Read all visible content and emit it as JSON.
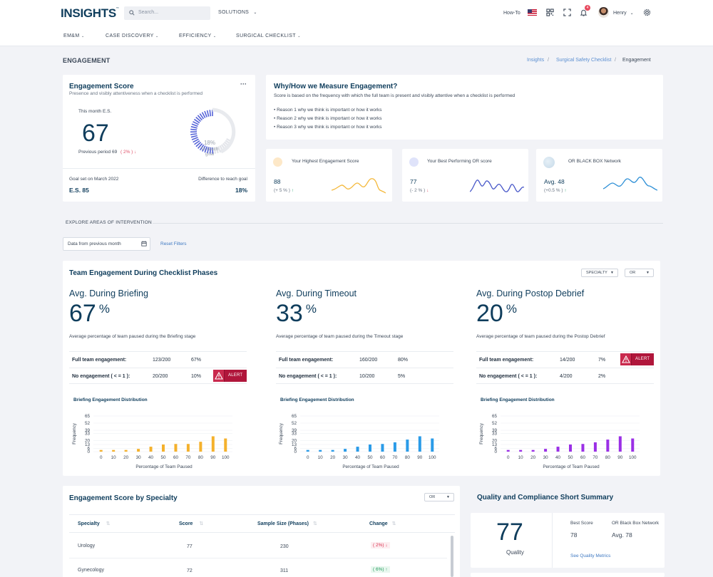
{
  "header": {
    "logo": "INSIGHTS",
    "logo_tm": "™",
    "search_placeholder": "Search...",
    "solutions": "SOLUTIONS",
    "howto": "How-To",
    "notifications_count": "4",
    "user_name": "Henry"
  },
  "nav": [
    "EM&M",
    "CASE DISCOVERY",
    "EFFICIENCY",
    "SURGICAL CHECKLIST"
  ],
  "page": {
    "title": "ENGAGEMENT",
    "breadcrumb": [
      "Insights",
      "Surgical Safety Checklist",
      "Engagement"
    ]
  },
  "es_card": {
    "title": "Engagement Score",
    "subtitle": "Presence and visibly attentiveness when a checklist is performed",
    "this_month_label": "This month E.S.",
    "value": "67",
    "previous_label": "Previous period 69",
    "previous_change": "( 2% )",
    "gauge_pct": "18%",
    "gauge_label_1": "To reach",
    "gauge_label_2": "goal",
    "gauge_fill": 0.18,
    "goal_label": "Goal set on March 2022",
    "goal_value": "E.S. 85",
    "diff_label": "Difference to reach goal",
    "diff_value": "18%"
  },
  "why_card": {
    "title": "Why/How we Measure Engagement?",
    "desc": "Score is based on the frequency with which the full team is present and visibly attentive when a checklist is performed",
    "reasons": [
      "Reason 1 why we think is important or how it works",
      "Reason 2 why we think is important or how it works",
      "Reason 3 why we think is important or how it works"
    ]
  },
  "mini_cards": [
    {
      "label": "Your Highest Engagement Score",
      "value": "88",
      "change": "(+ 5 % )",
      "color": "#f4b83a",
      "dot": "#fde8c8"
    },
    {
      "label": "Your Best Performing OR score",
      "value": "77",
      "change": "(- 2 % )",
      "color": "#4656c8",
      "dot": "#dfe3fa"
    },
    {
      "label": "OR BLACK BOX Network",
      "value": "Avg. 48",
      "change": "(+0.5 % )",
      "color": "#2d8fd6",
      "dot": "#d9e9f4"
    }
  ],
  "explore": {
    "title": "EXPLORE AREAS OF INTERVENTION",
    "date_filter": "Data from previous month",
    "reset": "Reset Filters"
  },
  "phases": {
    "title": "Team Engagement During Checklist Phases",
    "specialty_dd": "SPECIALTY",
    "or_dd": "OR",
    "full_label": "Full team engagement:",
    "no_label": "No engagement ( < = 1 ):",
    "alert": "ALERT",
    "chart_title": "Briefing Engagement Distribution",
    "y_label": "Frequency",
    "x_label": "Percentage of Team Paused",
    "items": [
      {
        "title": "Avg. During Briefing",
        "value": "67",
        "unit": "%",
        "desc": "Average percentage of team paused during the Briefing stage",
        "full_ratio": "123/200",
        "full_pct": "67%",
        "no_ratio": "20/200",
        "no_pct": "10%"
      },
      {
        "title": "Avg. During Timeout",
        "value": "33",
        "unit": "%",
        "desc": "Average percentage of team paused during the Timeout stage",
        "full_ratio": "160/200",
        "full_pct": "80%",
        "no_ratio": "10/200",
        "no_pct": "5%"
      },
      {
        "title": "Avg. During Postop Debrief",
        "value": "20",
        "unit": "%",
        "desc": "Average percentage of team paused during the Postop Debrief",
        "full_ratio": "14/200",
        "full_pct": "7%",
        "no_ratio": "4/200",
        "no_pct": "2%"
      }
    ]
  },
  "chart_data": [
    {
      "type": "bar",
      "title": "Briefing Engagement Distribution",
      "xlabel": "Percentage of Team Paused",
      "ylabel": "Frequency",
      "categories": [
        "0",
        "10",
        "20",
        "30",
        "40",
        "50",
        "60",
        "70",
        "80",
        "90",
        "100"
      ],
      "values": [
        3,
        3,
        3,
        5,
        9,
        13,
        14,
        14,
        18,
        28,
        24
      ],
      "yticks": [
        0,
        6,
        13,
        20,
        33,
        39,
        52,
        65
      ],
      "ylim": [
        0,
        65
      ],
      "color": "#f4b12c"
    },
    {
      "type": "bar",
      "title": "Briefing Engagement Distribution",
      "xlabel": "Percentage of Team Paused",
      "ylabel": "Frequency",
      "categories": [
        "0",
        "10",
        "20",
        "30",
        "40",
        "50",
        "60",
        "70",
        "80",
        "90",
        "100"
      ],
      "values": [
        3,
        3,
        3,
        5,
        9,
        13,
        14,
        17,
        22,
        28,
        24
      ],
      "yticks": [
        0,
        6,
        13,
        20,
        33,
        39,
        52,
        65
      ],
      "ylim": [
        0,
        65
      ],
      "color": "#2a9be8"
    },
    {
      "type": "bar",
      "title": "Briefing Engagement Distribution",
      "xlabel": "Percentage of Team Paused",
      "ylabel": "Frequency",
      "categories": [
        "0",
        "10",
        "20",
        "30",
        "40",
        "50",
        "60",
        "70",
        "80",
        "90",
        "100"
      ],
      "values": [
        3,
        3,
        3,
        5,
        9,
        13,
        14,
        17,
        22,
        28,
        24
      ],
      "yticks": [
        0,
        6,
        13,
        20,
        33,
        39,
        52,
        65
      ],
      "ylim": [
        0,
        65
      ],
      "color": "#9a2fe6"
    }
  ],
  "specialty": {
    "title": "Engagement Score by Specialty",
    "or_dd": "OR",
    "columns": [
      "Specialty",
      "Score",
      "Sample Size (Phases)",
      "Change"
    ],
    "rows": [
      {
        "name": "Urology",
        "score": "77",
        "sample": "230",
        "change": "( 2%)",
        "dir": "down"
      },
      {
        "name": "Gynecology",
        "score": "72",
        "sample": "311",
        "change": "( 6%)",
        "dir": "up"
      }
    ]
  },
  "quality": {
    "title": "Quality and Compliance Short Summary",
    "value": "77",
    "value_label": "Quality",
    "best_label": "Best Score",
    "best_value": "78",
    "network_label": "OR Black Box Network",
    "network_value": "Avg. 78",
    "link": "See Quality Metrics"
  }
}
